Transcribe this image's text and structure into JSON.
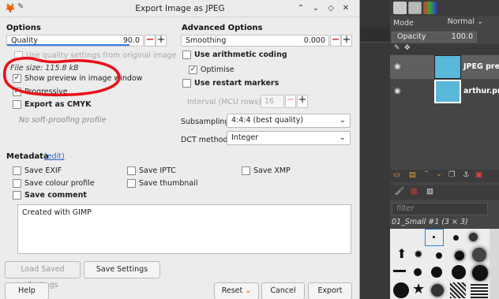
{
  "dialog": {
    "title": "Export Image as JPEG",
    "options_header": "Options",
    "quality": {
      "label": "Quality",
      "value": "90.0",
      "level": 0.9
    },
    "use_quality_from_original": "Use quality settings from original image",
    "file_size": "File size: 115.8 kB",
    "show_preview": "Show preview in image window",
    "progressive": "Progressive",
    "export_cmyk": "Export as CMYK",
    "no_soft_proofing": "No soft-proofing profile",
    "advanced_header": "Advanced Options",
    "smoothing": {
      "label": "Smoothing",
      "value": "0.000",
      "level": 0.0
    },
    "use_arithmetic": "Use arithmetic coding",
    "optimise": "Optimise",
    "use_restart_markers": "Use restart markers",
    "interval_label": "Interval (MCU rows):",
    "interval_value": "16",
    "subsampling_label": "Subsampling",
    "subsampling_value": "4:4:4 (best quality)",
    "dct_label": "DCT method",
    "dct_value": "Integer",
    "metadata_header": "Metadata",
    "metadata_edit": "(edit)",
    "save_exif": "Save EXIF",
    "save_iptc": "Save IPTC",
    "save_xmp": "Save XMP",
    "save_colour_profile": "Save colour profile",
    "save_thumbnail": "Save thumbnail",
    "save_comment": "Save comment",
    "comment_text": "Created with GIMP",
    "load_saved_settings": "Load Saved Settings",
    "save_settings": "Save Settings",
    "help": "Help",
    "reset": "Reset",
    "cancel": "Cancel",
    "export": "Export"
  },
  "layers_panel": {
    "mode_label": "Mode",
    "mode_value": "Normal",
    "opacity_label": "Opacity",
    "opacity_value": "100.0",
    "layers": [
      "JPEG preview",
      "arthur.png"
    ],
    "filter_placeholder": "filter",
    "brush_name": "01_Small #1 (3 × 3)"
  },
  "colors": {
    "accent": "#3b78e7",
    "annotation": "#e8101a",
    "minus": "#d23030"
  }
}
